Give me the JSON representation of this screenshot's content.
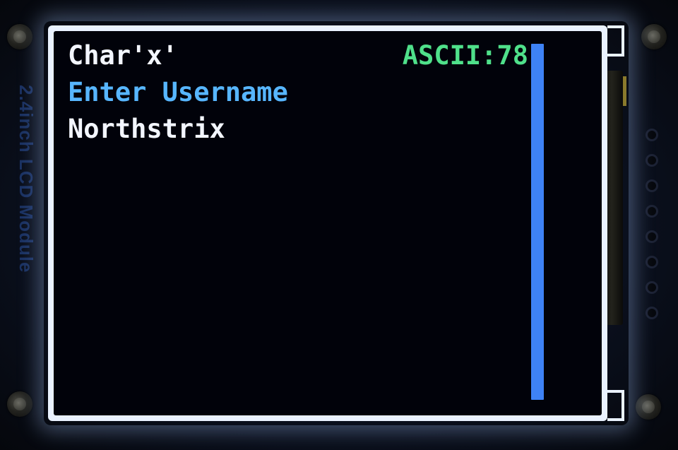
{
  "board": {
    "label": "2.4inch LCD Module"
  },
  "lcd": {
    "char_line": "Char'x'",
    "ascii_line": "ASCII:78",
    "prompt_line": "Enter Username",
    "username_value": "Northstrix",
    "colors": {
      "background": "#01020a",
      "text_white": "#f3f6ff",
      "ascii_green": "#4fe08a",
      "prompt_blue": "#57b6ff",
      "scrollbar_blue": "#3e82f5"
    }
  }
}
